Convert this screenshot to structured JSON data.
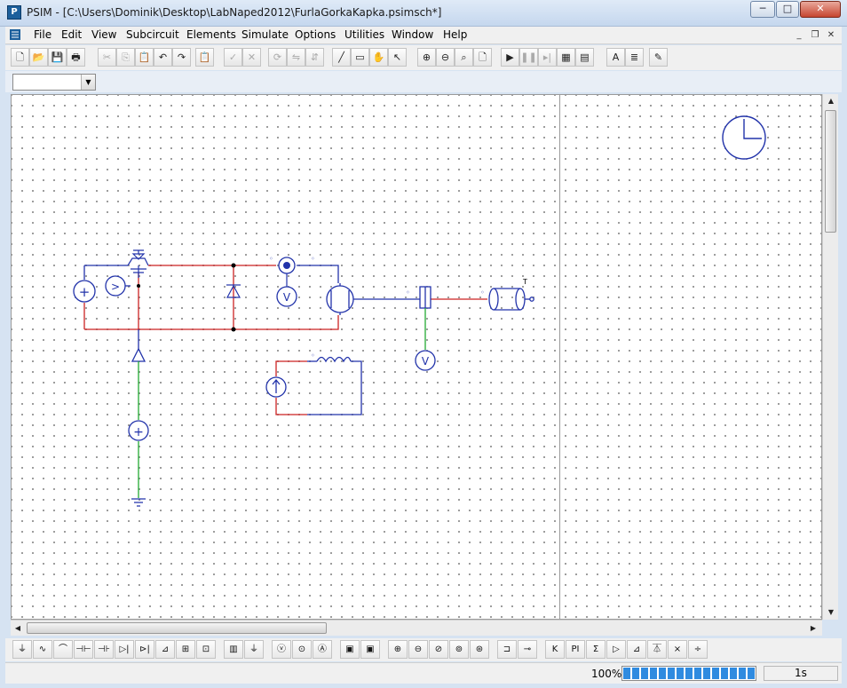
{
  "window": {
    "app_icon_label": "P",
    "title": "PSIM - [C:\\Users\\Dominik\\Desktop\\LabNaped2012\\FurlaGorkaKapka.psimsch*]",
    "minimize_label": "─",
    "maximize_label": "□",
    "close_label": "✕"
  },
  "menubar": {
    "items": [
      "File",
      "Edit",
      "View",
      "Subcircuit",
      "Elements",
      "Simulate",
      "Options",
      "Utilities",
      "Window",
      "Help"
    ],
    "mdi_minimize": "_",
    "mdi_restore": "❐",
    "mdi_close": "✕"
  },
  "toolbar": {
    "buttons": [
      {
        "icon": "new-icon",
        "glyph": "🗋"
      },
      {
        "icon": "open-icon",
        "glyph": "📂"
      },
      {
        "icon": "save-icon",
        "glyph": "💾"
      },
      {
        "icon": "print-icon",
        "glyph": "🖶"
      },
      {
        "icon": "cut-icon",
        "glyph": "✂"
      },
      {
        "icon": "copy-icon",
        "glyph": "⎘"
      },
      {
        "icon": "paste-icon",
        "glyph": "📋"
      },
      {
        "icon": "undo-icon",
        "glyph": "↶"
      },
      {
        "icon": "redo-icon",
        "glyph": "↷"
      },
      {
        "icon": "clipboard-icon",
        "glyph": "📋"
      },
      {
        "icon": "check-icon",
        "glyph": "✓"
      },
      {
        "icon": "cancel-icon",
        "glyph": "✕"
      },
      {
        "icon": "rotate-icon",
        "glyph": "⟳"
      },
      {
        "icon": "flip-lr-icon",
        "glyph": "⇋"
      },
      {
        "icon": "flip-tb-icon",
        "glyph": "⇵"
      },
      {
        "icon": "wire-icon",
        "glyph": "╱"
      },
      {
        "icon": "label-icon",
        "glyph": "▭"
      },
      {
        "icon": "pan-hand-icon",
        "glyph": "✋"
      },
      {
        "icon": "pointer-icon",
        "glyph": "↖"
      },
      {
        "icon": "zoom-in-icon",
        "glyph": "⊕"
      },
      {
        "icon": "zoom-out-icon",
        "glyph": "⊖"
      },
      {
        "icon": "zoom-fit-icon",
        "glyph": "⌕"
      },
      {
        "icon": "page-icon",
        "glyph": "🗋"
      },
      {
        "icon": "run-simulation-icon",
        "glyph": "▶"
      },
      {
        "icon": "pause-icon",
        "glyph": "❚❚"
      },
      {
        "icon": "step-icon",
        "glyph": "▸|"
      },
      {
        "icon": "simview-icon",
        "glyph": "▦"
      },
      {
        "icon": "library-icon",
        "glyph": "▤"
      },
      {
        "icon": "text-icon",
        "glyph": "A"
      },
      {
        "icon": "notes-icon",
        "glyph": "≣"
      },
      {
        "icon": "edit-icon",
        "glyph": "✎"
      }
    ]
  },
  "combo": {
    "value": "",
    "arrow": "▼"
  },
  "scrollbars": {
    "up": "▲",
    "down": "▼",
    "left": "◀",
    "right": "▶"
  },
  "schematic": {
    "torque_label": "T",
    "voltmeter_label": "V",
    "plus_label": "+",
    "comparator_label": ">"
  },
  "element_toolbar": {
    "buttons": [
      {
        "icon": "resistor-icon",
        "glyph": "⏚"
      },
      {
        "icon": "inductor-icon",
        "glyph": "∿"
      },
      {
        "icon": "inductor-coil-icon",
        "glyph": "⌒"
      },
      {
        "icon": "capacitor-icon",
        "glyph": "⊣⊢"
      },
      {
        "icon": "capacitor-polar-icon",
        "glyph": "⊣⊦"
      },
      {
        "icon": "diode-icon",
        "glyph": "▷|"
      },
      {
        "icon": "thyristor-icon",
        "glyph": "⊳|"
      },
      {
        "icon": "igbt-icon",
        "glyph": "⊿"
      },
      {
        "icon": "mosfet-icon",
        "glyph": "⊞"
      },
      {
        "icon": "switch-module-icon",
        "glyph": "⊡"
      },
      {
        "icon": "bridge-icon",
        "glyph": "▥"
      },
      {
        "icon": "ground-icon",
        "glyph": "⏚"
      },
      {
        "icon": "voltage-probe-icon",
        "glyph": "ⓥ"
      },
      {
        "icon": "ac-source-icon",
        "glyph": "⊙"
      },
      {
        "icon": "current-source-icon",
        "glyph": "Ⓐ"
      },
      {
        "icon": "scope-icon",
        "glyph": "▣"
      },
      {
        "icon": "scope-2-icon",
        "glyph": "▣"
      },
      {
        "icon": "voltmeter-icon",
        "glyph": "⊕"
      },
      {
        "icon": "ammeter-icon",
        "glyph": "⊖"
      },
      {
        "icon": "dc-source-icon",
        "glyph": "⊘"
      },
      {
        "icon": "sine-source-icon",
        "glyph": "⊚"
      },
      {
        "icon": "step-source-icon",
        "glyph": "⊛"
      },
      {
        "icon": "switch-controller-icon",
        "glyph": "⊐"
      },
      {
        "icon": "gating-block-icon",
        "glyph": "⊸"
      },
      {
        "icon": "k-gain-icon",
        "glyph": "K"
      },
      {
        "icon": "pi-block-icon",
        "glyph": "PI"
      },
      {
        "icon": "summer-icon",
        "glyph": "Σ"
      },
      {
        "icon": "comparator-icon",
        "glyph": "▷"
      },
      {
        "icon": "limiter-icon",
        "glyph": "⊿"
      },
      {
        "icon": "ground-node-icon",
        "glyph": "⏄"
      },
      {
        "icon": "multiplier-icon",
        "glyph": "×"
      },
      {
        "icon": "divider-icon",
        "glyph": "÷"
      }
    ]
  },
  "statusbar": {
    "zoom": "100%",
    "progress_fraction": 1.0,
    "time": "1s"
  }
}
